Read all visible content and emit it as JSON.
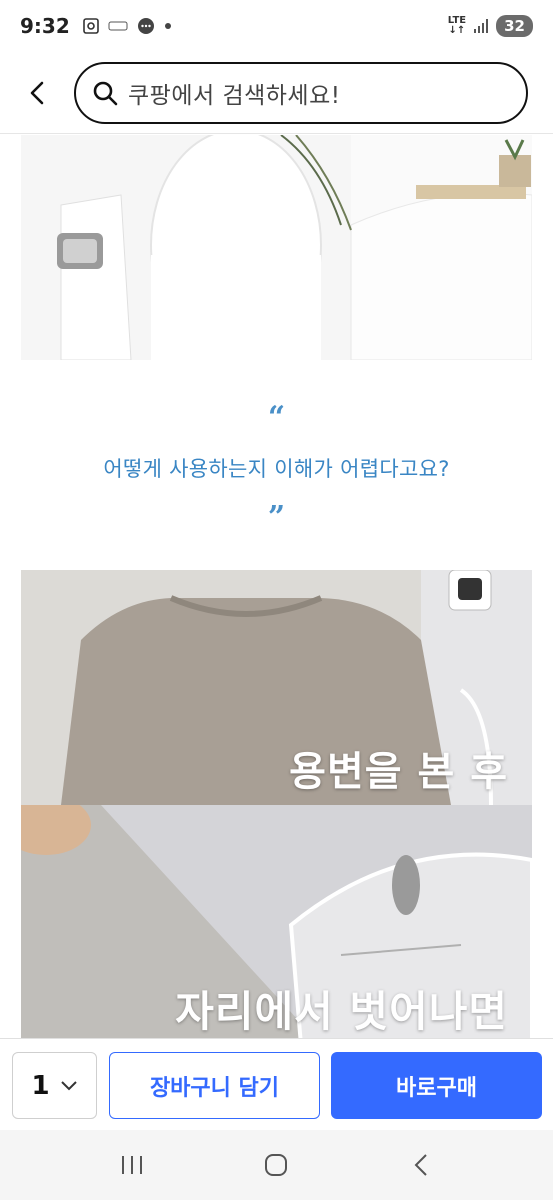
{
  "status_bar": {
    "time": "9:32",
    "network_label": "LTE",
    "battery": "32",
    "icons": [
      "screenshot-icon",
      "carrier-icon",
      "chat-icon",
      "dot-icon",
      "signal-icon",
      "battery-icon"
    ]
  },
  "header": {
    "search_placeholder": "쿠팡에서 검색하세요!",
    "icons": [
      "back-arrow-icon",
      "search-icon"
    ]
  },
  "content": {
    "quote_open": "“",
    "question": "어떻게 사용하는지 이해가 어렵다고요?",
    "quote_close": "”",
    "image2_caption": "용변을 본 후",
    "image3_caption": "자리에서 벗어나면"
  },
  "buy_bar": {
    "quantity": "1",
    "cart_label": "장바구니 담기",
    "buy_label": "바로구매",
    "accent_color": "#346aff"
  },
  "nav_bar": {
    "icons": [
      "recent-apps-icon",
      "home-icon",
      "back-icon"
    ]
  }
}
